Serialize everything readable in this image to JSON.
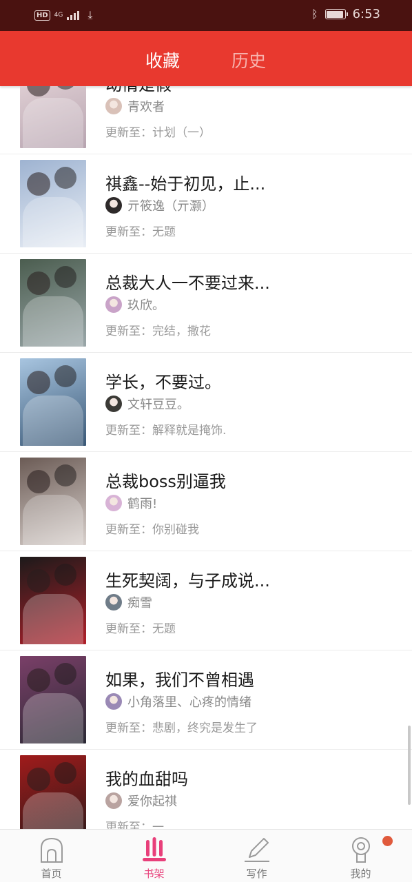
{
  "status_bar": {
    "hd": "HD",
    "network": "4G",
    "time": "6:53",
    "battery_level": 0.95
  },
  "header": {
    "tabs": [
      {
        "label": "收藏",
        "active": true
      },
      {
        "label": "历史",
        "active": false
      }
    ]
  },
  "list": {
    "items": [
      {
        "title": "动情是假",
        "author": "青欢者",
        "update": "更新至：计划（一）",
        "cover_colors": [
          "#e9d9dc",
          "#b7a4b0"
        ],
        "avatar_color": "#d9c1b8"
      },
      {
        "title": "祺鑫--始于初见，止...",
        "author": "亓筱逸（亓灏）",
        "update": "更新至：无题",
        "cover_colors": [
          "#9eb3d1",
          "#e9eef5"
        ],
        "avatar_color": "#2e2a2a"
      },
      {
        "title": "总裁大人一不要过来...",
        "author": "玖欣。",
        "update": "更新至：完结，撒花",
        "cover_colors": [
          "#4b5d4f",
          "#9aa7a9"
        ],
        "avatar_color": "#c9a3c8"
      },
      {
        "title": "学长，不要过。",
        "author": "文轩豆豆。",
        "update": "更新至：解释就是掩饰.",
        "cover_colors": [
          "#a8c5e0",
          "#3a5876"
        ],
        "avatar_color": "#3b3a36"
      },
      {
        "title": "总裁boss别逼我",
        "author": "鹤雨!",
        "update": "更新至：你别碰我",
        "cover_colors": [
          "#6b5b55",
          "#d8d0cc"
        ],
        "avatar_color": "#d8b3d6"
      },
      {
        "title": "生死契阔，与子成说...",
        "author": "痴雪",
        "update": "更新至：无题",
        "cover_colors": [
          "#1c1a1a",
          "#b0202a"
        ],
        "avatar_color": "#6f7c88"
      },
      {
        "title": "如果，我们不曾相遇",
        "author": "小角落里、心疼的情绪",
        "update": "更新至：悲剧，终究是发生了",
        "cover_colors": [
          "#7a3f68",
          "#2b2a35"
        ],
        "avatar_color": "#9a89b5"
      },
      {
        "title": "我的血甜吗",
        "author": "爱你起祺",
        "update": "更新至：一",
        "cover_colors": [
          "#a01b1b",
          "#2b1a1a"
        ],
        "avatar_color": "#b9a3a0"
      }
    ]
  },
  "tabbar": {
    "items": [
      {
        "label": "首页",
        "icon": "home-icon",
        "active": false
      },
      {
        "label": "书架",
        "icon": "bookshelf-icon",
        "active": true
      },
      {
        "label": "写作",
        "icon": "pen-icon",
        "active": false
      },
      {
        "label": "我的",
        "icon": "profile-icon",
        "active": false
      }
    ]
  },
  "colors": {
    "accent": "#e8392f",
    "status_bar": "#4a1210",
    "active_tab": "#e83f7a",
    "notification_dot": "#e05a3c"
  }
}
